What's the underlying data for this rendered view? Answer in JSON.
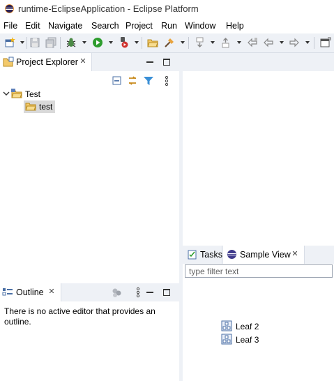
{
  "window": {
    "title": "runtime-EclipseApplication - Eclipse Platform"
  },
  "menu": {
    "items": [
      "File",
      "Edit",
      "Navigate",
      "Search",
      "Project",
      "Run",
      "Window",
      "Help"
    ]
  },
  "toolbar": {
    "icons": [
      "new-wizard-icon",
      "save-icon",
      "save-all-icon",
      "debug-icon",
      "run-icon",
      "run-external-tool-icon",
      "open-type-icon",
      "open-task-icon",
      "next-annotation-icon",
      "previous-annotation-icon",
      "last-edit-location-icon",
      "back-icon",
      "forward-icon",
      "open-perspective-icon"
    ]
  },
  "project_explorer": {
    "tab_label": "Project Explorer",
    "tree": [
      {
        "label": "Test",
        "expanded": true,
        "children": [
          {
            "label": "test",
            "selected": true
          }
        ]
      }
    ]
  },
  "outline": {
    "tab_label": "Outline",
    "message": "There is no active editor that provides an outline."
  },
  "bottom_right": {
    "tabs": [
      {
        "label": "Tasks",
        "active": false
      },
      {
        "label": "Sample View",
        "active": true
      }
    ],
    "filter_placeholder": "type filter text",
    "items": [
      "Leaf 2",
      "Leaf 3"
    ]
  },
  "colors": {
    "chrome": "#eef1f6",
    "border": "#d8dde6",
    "selection": "#d9d9d9",
    "run_green": "#2e9d2e"
  }
}
